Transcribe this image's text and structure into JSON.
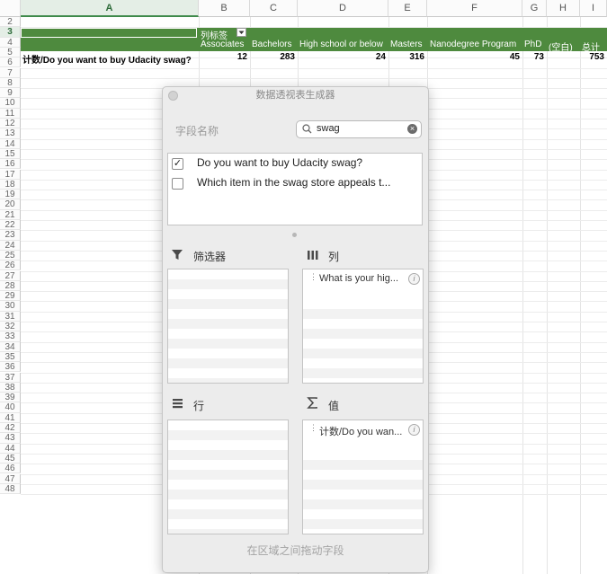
{
  "sheet": {
    "columns": [
      {
        "id": "a",
        "label": "A"
      },
      {
        "id": "b",
        "label": "B"
      },
      {
        "id": "c",
        "label": "C"
      },
      {
        "id": "d",
        "label": "D"
      },
      {
        "id": "e",
        "label": "E"
      },
      {
        "id": "f",
        "label": "F"
      },
      {
        "id": "g",
        "label": "G"
      },
      {
        "id": "h",
        "label": "H"
      },
      {
        "id": "i",
        "label": "I"
      }
    ],
    "rows": [
      "2",
      "3",
      "4",
      "5",
      "6",
      "7",
      "8",
      "9",
      "10",
      "11",
      "12",
      "13",
      "14",
      "15",
      "16",
      "17",
      "18",
      "19",
      "20",
      "21",
      "22",
      "23",
      "24",
      "25",
      "26",
      "27",
      "28",
      "29",
      "30",
      "31",
      "32",
      "33",
      "34",
      "35",
      "36",
      "37",
      "38",
      "39",
      "40",
      "41",
      "42",
      "43",
      "44",
      "45",
      "46",
      "47",
      "48"
    ],
    "pivot": {
      "column_labels_caption": "列标签",
      "headers": [
        "Associates",
        "Bachelors",
        "High school or below",
        "Masters",
        "Nanodegree Program",
        "PhD",
        "(空白)",
        "总计"
      ],
      "row_label": "计数/Do you want to buy Udacity swag?",
      "values": [
        "12",
        "283",
        "24",
        "316",
        "45",
        "73",
        "",
        "753"
      ]
    }
  },
  "panel": {
    "title": "数据透视表生成器",
    "field_name_label": "字段名称",
    "search": {
      "value": "swag",
      "clear": "×"
    },
    "fields": [
      {
        "label": "Do you want to buy Udacity swag?",
        "checked": "✓"
      },
      {
        "label": "Which item in the swag store appeals t...",
        "checked": ""
      }
    ],
    "areas": {
      "filters": {
        "label": "筛选器"
      },
      "columns": {
        "label": "列",
        "items": [
          {
            "label": "What is your hig..."
          }
        ]
      },
      "rows": {
        "label": "行"
      },
      "values": {
        "label": "值",
        "items": [
          {
            "label": "计数/Do you wan..."
          }
        ]
      }
    },
    "footer": "在区域之间拖动字段",
    "colors": {
      "pivot_green": "#4e8a3e",
      "panel_bg": "#ececec"
    }
  }
}
